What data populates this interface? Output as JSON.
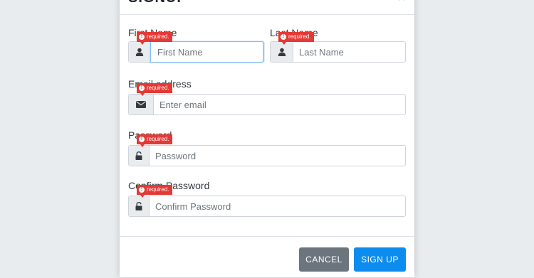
{
  "modal": {
    "title": "SIGNUP",
    "close_glyph": "×"
  },
  "fields": {
    "first_name": {
      "label": "First Name",
      "placeholder": "First Name",
      "icon": "user-icon",
      "error": "required."
    },
    "last_name": {
      "label": "Last Name",
      "placeholder": "Last Name",
      "icon": "user-icon",
      "error": "required."
    },
    "email": {
      "label": "Email address",
      "placeholder": "Enter email",
      "icon": "envelope-icon",
      "error": "required."
    },
    "password": {
      "label": "Password",
      "placeholder": "Password",
      "icon": "unlock-icon",
      "error": "required."
    },
    "confirm_password": {
      "label": "Confirm Password",
      "placeholder": "Confirm Password",
      "icon": "unlock-icon",
      "error": "required."
    }
  },
  "error_icon_glyph": "!",
  "footer": {
    "cancel_label": "CANCEL",
    "signup_label": "SIGN UP"
  },
  "colors": {
    "primary": "#0d8cf0",
    "secondary": "#6c757d",
    "error": "#e53935",
    "focus_border": "#80bdff"
  }
}
